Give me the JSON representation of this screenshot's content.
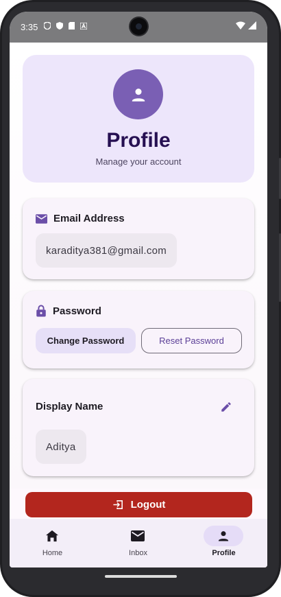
{
  "status_bar": {
    "time": "3:35",
    "left_icons": [
      "shield-icon",
      "security-icon",
      "sd-card-icon",
      "a-icon"
    ],
    "right_icons": [
      "wifi-icon",
      "signal-icon"
    ]
  },
  "header": {
    "title": "Profile",
    "subtitle": "Manage your account",
    "avatar_icon": "person-icon"
  },
  "email_card": {
    "label": "Email Address",
    "value": "karaditya381@gmail.com",
    "icon": "mail-icon"
  },
  "password_card": {
    "label": "Password",
    "change_label": "Change Password",
    "reset_label": "Reset Password",
    "icon": "lock-icon"
  },
  "display_name_card": {
    "label": "Display Name",
    "value": "Aditya",
    "edit_icon": "pencil-icon"
  },
  "logout": {
    "label": "Logout",
    "icon": "logout-icon"
  },
  "nav": {
    "items": [
      {
        "label": "Home",
        "icon": "home-icon",
        "active": false
      },
      {
        "label": "Inbox",
        "icon": "mail-icon",
        "active": false
      },
      {
        "label": "Profile",
        "icon": "person-icon",
        "active": true
      }
    ]
  },
  "colors": {
    "primary": "#7a5fb4",
    "header_bg": "#ede6fb",
    "title": "#261052",
    "logout": "#b3261e",
    "nav_active": "#e5dcf7",
    "icon": "#6b4ea8"
  }
}
